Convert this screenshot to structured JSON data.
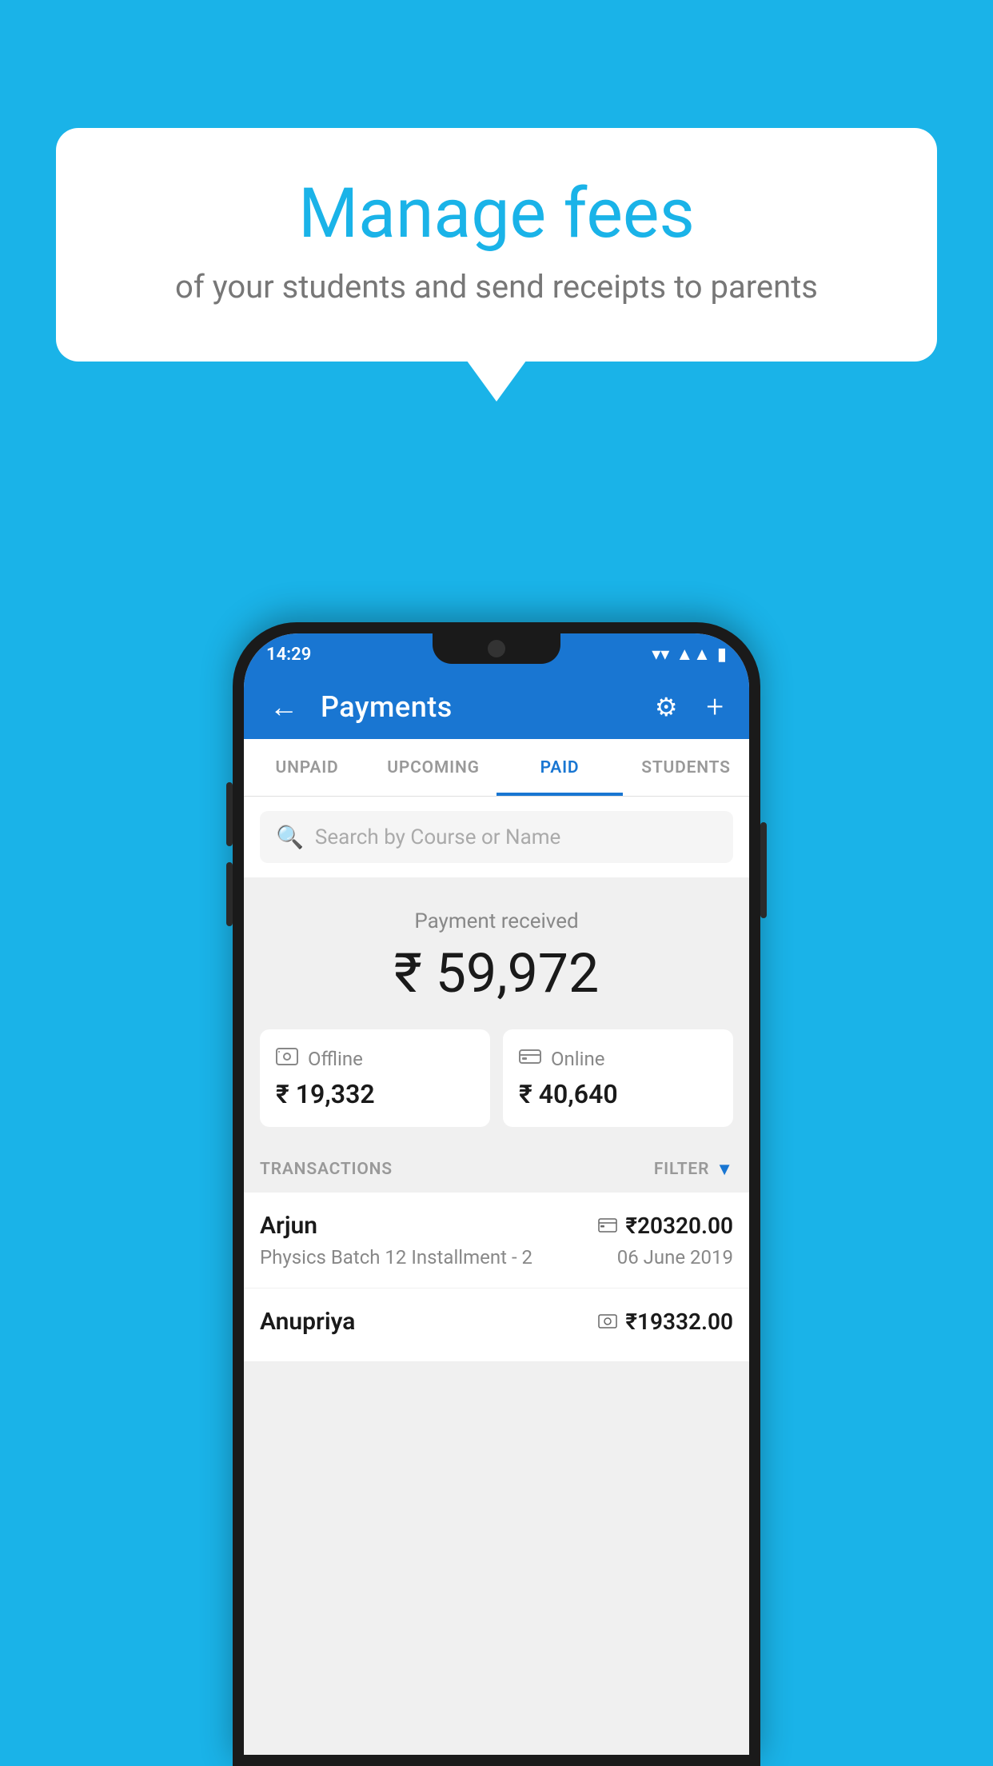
{
  "page": {
    "bg_color": "#1ab3e8"
  },
  "bubble": {
    "title": "Manage fees",
    "subtitle": "of your students and send receipts to parents"
  },
  "status_bar": {
    "time": "14:29",
    "wifi": "▼",
    "signal": "▲",
    "battery": "▮"
  },
  "app_bar": {
    "title": "Payments",
    "back_icon": "←",
    "settings_icon": "⚙",
    "add_icon": "+"
  },
  "tabs": [
    {
      "label": "UNPAID",
      "active": false
    },
    {
      "label": "UPCOMING",
      "active": false
    },
    {
      "label": "PAID",
      "active": true
    },
    {
      "label": "STUDENTS",
      "active": false
    }
  ],
  "search": {
    "placeholder": "Search by Course or Name"
  },
  "payment_received": {
    "label": "Payment received",
    "amount": "₹ 59,972"
  },
  "payment_cards": [
    {
      "type": "Offline",
      "icon": "💵",
      "amount": "₹ 19,332"
    },
    {
      "type": "Online",
      "icon": "💳",
      "amount": "₹ 40,640"
    }
  ],
  "transactions_section": {
    "label": "TRANSACTIONS",
    "filter_label": "FILTER"
  },
  "transactions": [
    {
      "name": "Arjun",
      "course": "Physics Batch 12 Installment - 2",
      "amount": "₹20320.00",
      "date": "06 June 2019",
      "payment_icon": "💳"
    },
    {
      "name": "Anupriya",
      "course": "",
      "amount": "₹19332.00",
      "date": "",
      "payment_icon": "💵"
    }
  ]
}
